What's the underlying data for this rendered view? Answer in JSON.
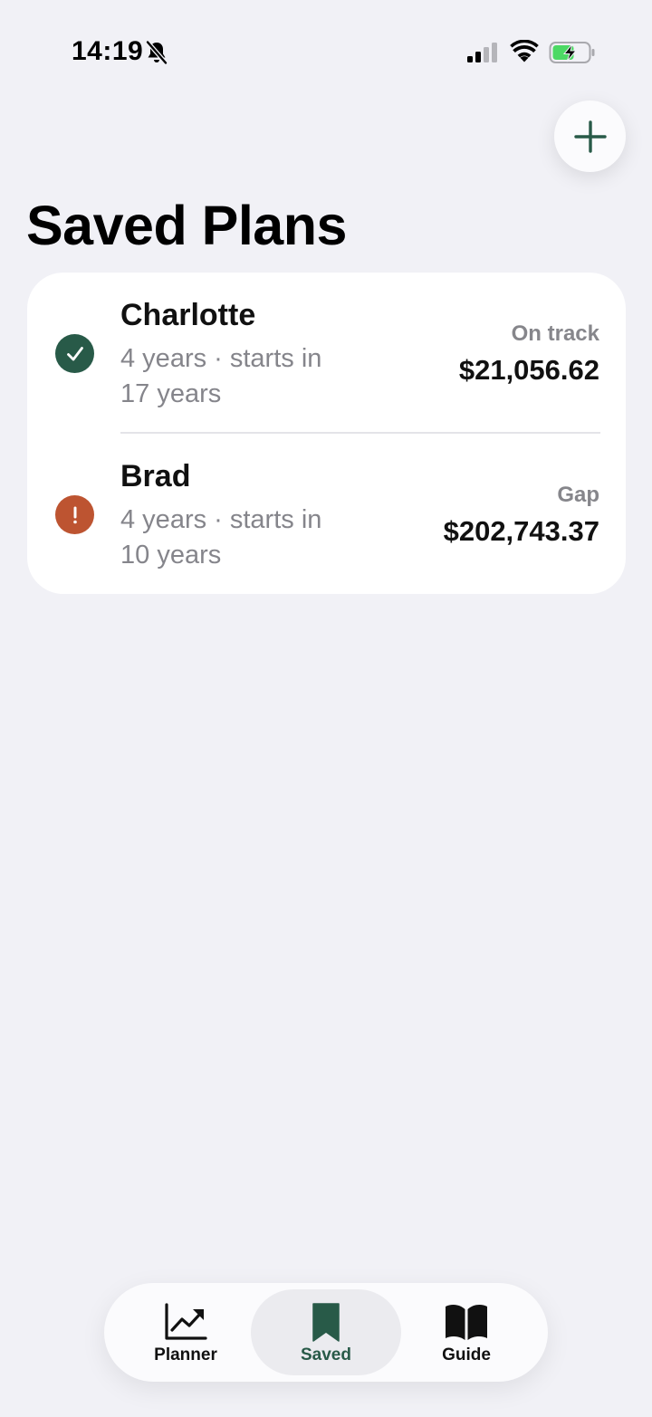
{
  "status_bar": {
    "time": "14:19",
    "icons": [
      "bell-slash-icon",
      "signal-icon",
      "wifi-icon",
      "battery-charging-icon"
    ]
  },
  "header": {
    "add_icon": "plus-icon",
    "title": "Saved Plans"
  },
  "plans": [
    {
      "name": "Charlotte",
      "detail": "4 years · starts in 17 years",
      "status_label": "On track",
      "amount": "$21,056.62",
      "status_icon": "checkmark-icon",
      "status_color": "#285a48"
    },
    {
      "name": "Brad",
      "detail": "4 years · starts in 10 years",
      "status_label": "Gap",
      "amount": "$202,743.37",
      "status_icon": "exclamation-icon",
      "status_color": "#bd5431"
    }
  ],
  "tab_bar": {
    "tabs": [
      {
        "label": "Planner",
        "icon": "chart-line-icon",
        "selected": false
      },
      {
        "label": "Saved",
        "icon": "bookmark-icon",
        "selected": true
      },
      {
        "label": "Guide",
        "icon": "book-icon",
        "selected": false
      }
    ]
  },
  "colors": {
    "accent": "#285a48",
    "warning": "#bd5431",
    "background": "#f1f1f6",
    "card": "#ffffff"
  }
}
